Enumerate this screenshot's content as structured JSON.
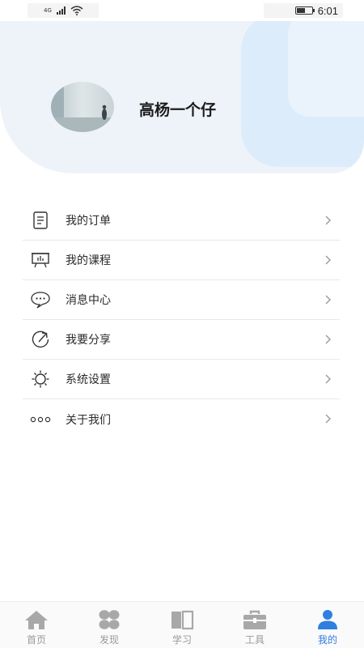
{
  "status_bar": {
    "network": "4G",
    "time": "6:01"
  },
  "profile": {
    "username": "高杨一个仔"
  },
  "menu": {
    "items": [
      {
        "label": "我的订单",
        "icon": "document-icon"
      },
      {
        "label": "我的课程",
        "icon": "board-icon"
      },
      {
        "label": "消息中心",
        "icon": "chat-bubble-icon"
      },
      {
        "label": "我要分享",
        "icon": "share-icon"
      },
      {
        "label": "系统设置",
        "icon": "sun-gear-icon"
      },
      {
        "label": "关于我们",
        "icon": "more-dots-icon"
      }
    ]
  },
  "tabbar": {
    "items": [
      {
        "label": "首页",
        "icon": "home-icon",
        "active": false
      },
      {
        "label": "发现",
        "icon": "grid-icon",
        "active": false
      },
      {
        "label": "学习",
        "icon": "book-icon",
        "active": false
      },
      {
        "label": "工具",
        "icon": "toolbox-icon",
        "active": false
      },
      {
        "label": "我的",
        "icon": "person-icon",
        "active": true
      }
    ],
    "active_color": "#2f7fe0",
    "inactive_color": "#9a9a9a"
  }
}
